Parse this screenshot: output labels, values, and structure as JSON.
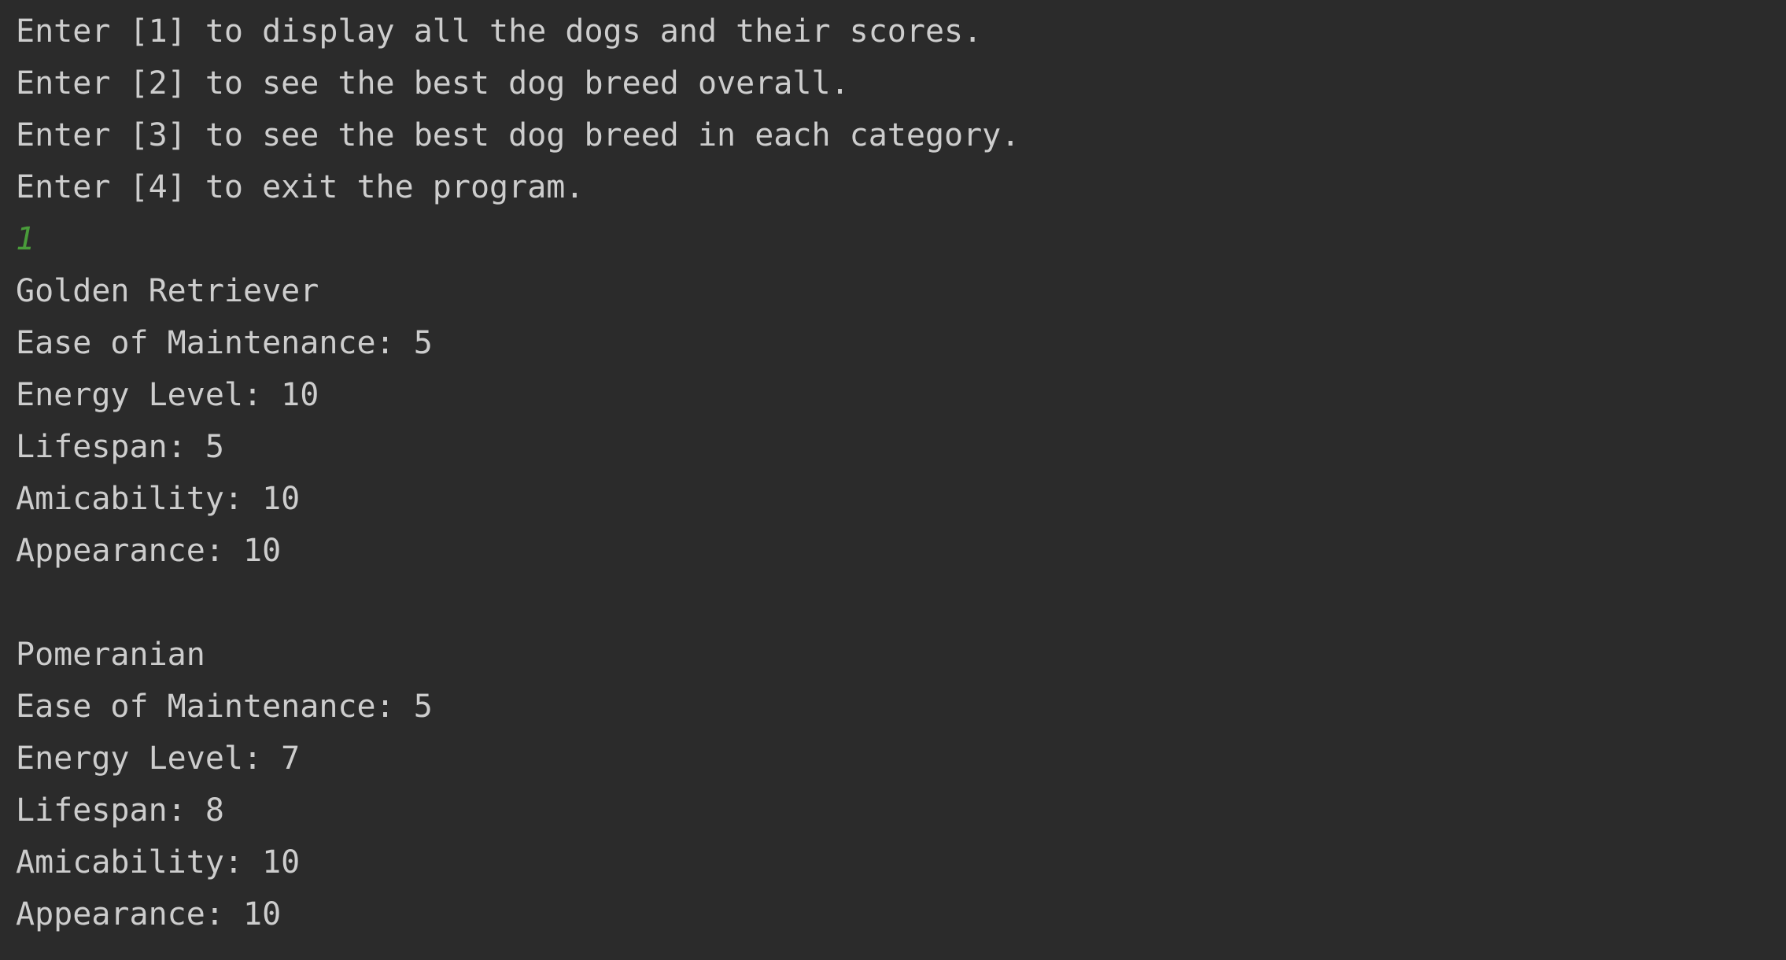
{
  "console": {
    "menu": [
      "Enter [1] to display all the dogs and their scores.",
      "Enter [2] to see the best dog breed overall.",
      "Enter [3] to see the best dog breed in each category.",
      "Enter [4] to exit the program."
    ],
    "user_input": "1",
    "dogs": [
      {
        "name": "Golden Retriever",
        "lines": [
          "Ease of Maintenance: 5",
          "Energy Level: 10",
          "Lifespan: 5",
          "Amicability: 10",
          "Appearance: 10"
        ]
      },
      {
        "name": "Pomeranian",
        "lines": [
          "Ease of Maintenance: 5",
          "Energy Level: 7",
          "Lifespan: 8",
          "Amicability: 10",
          "Appearance: 10"
        ]
      }
    ],
    "colors": {
      "background": "#2b2b2b",
      "text": "#cdcdcd",
      "input": "#499c3a"
    }
  }
}
